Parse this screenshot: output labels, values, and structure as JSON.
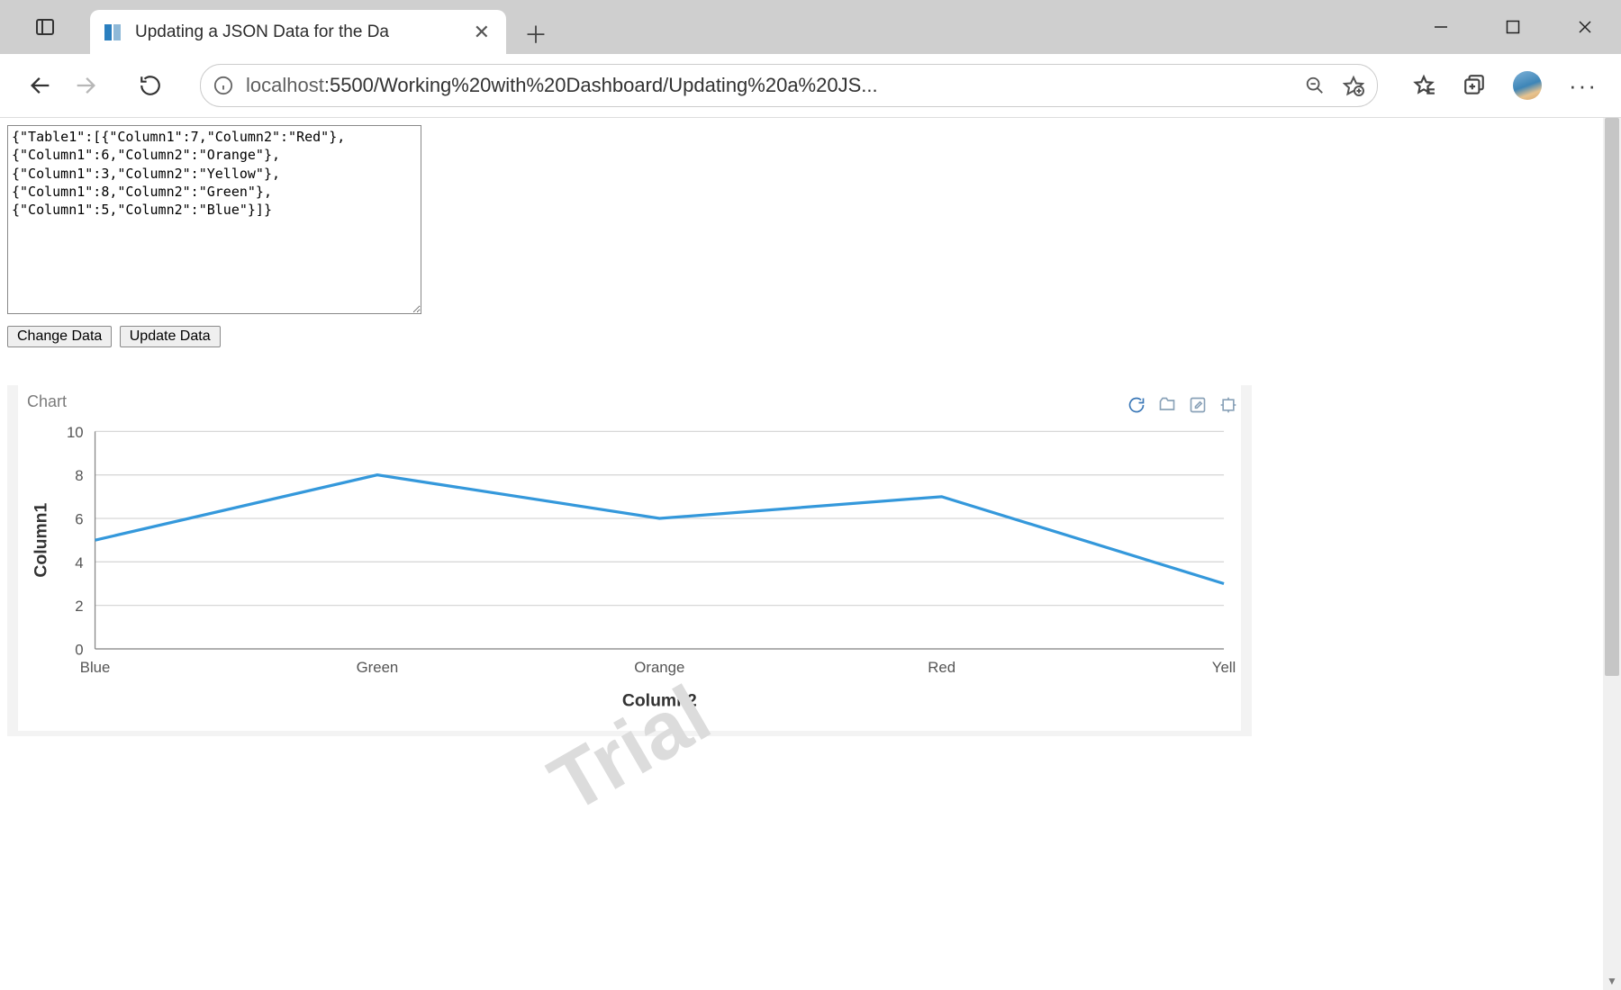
{
  "browser": {
    "tab_title": "Updating a JSON Data for the Da",
    "url_display": "localhost:5500/Working%20with%20Dashboard/Updating%20a%20JS...",
    "url_host": "localhost",
    "url_rest": ":5500/Working%20with%20Dashboard/Updating%20a%20JS..."
  },
  "textarea_value": "{\"Table1\":[{\"Column1\":7,\"Column2\":\"Red\"},\n{\"Column1\":6,\"Column2\":\"Orange\"},\n{\"Column1\":3,\"Column2\":\"Yellow\"},\n{\"Column1\":8,\"Column2\":\"Green\"},\n{\"Column1\":5,\"Column2\":\"Blue\"}]}",
  "buttons": {
    "change_data": "Change Data",
    "update_data": "Update Data"
  },
  "chart_card": {
    "title": "Chart",
    "watermark": "Trial"
  },
  "chart_data": {
    "type": "line",
    "title": "Chart",
    "xlabel": "Column2",
    "ylabel": "Column1",
    "categories": [
      "Blue",
      "Green",
      "Orange",
      "Red",
      "Yellow"
    ],
    "x_tick_labels_visible": [
      "Blue",
      "Green",
      "Orange",
      "Red",
      "Yell"
    ],
    "values": [
      5,
      8,
      6,
      7,
      3
    ],
    "y_ticks": [
      0,
      2,
      4,
      6,
      8,
      10
    ],
    "ylim": [
      0,
      10
    ],
    "line_color": "#3498db",
    "grid": true
  }
}
